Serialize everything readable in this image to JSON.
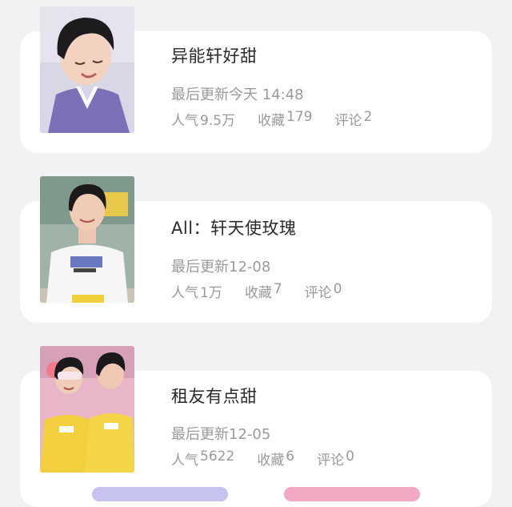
{
  "items": [
    {
      "title": "异能轩好甜",
      "updated_label": "最后更新",
      "updated_value": "今天 14:48",
      "popularity_label": "人气",
      "popularity_value": "9.5万",
      "favorites_label": "收藏",
      "favorites_value": "179",
      "comments_label": "评论",
      "comments_value": "2"
    },
    {
      "title": "All：轩天使玫瑰",
      "updated_label": "最后更新",
      "updated_value": "12-08",
      "popularity_label": "人气",
      "popularity_value": "1万",
      "favorites_label": "收藏",
      "favorites_value": "7",
      "comments_label": "评论",
      "comments_value": "0"
    },
    {
      "title": "租友有点甜",
      "updated_label": "最后更新",
      "updated_value": "12-05",
      "popularity_label": "人气",
      "popularity_value": "5622",
      "favorites_label": "收藏",
      "favorites_value": "6",
      "comments_label": "评论",
      "comments_value": "0"
    }
  ],
  "colors": {
    "background": "#f2f2f4",
    "card": "#ffffff",
    "title_text": "#2b2b2b",
    "meta_text": "#9a9a9a"
  }
}
